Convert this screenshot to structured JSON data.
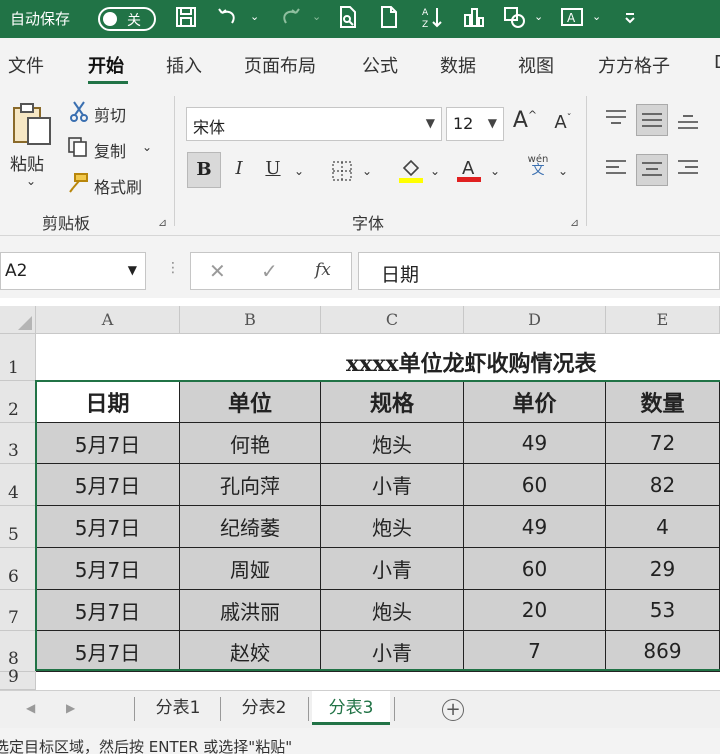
{
  "titlebar": {
    "autosave_label": "自动保存",
    "toggle_state": "关",
    "icons": [
      "save-icon",
      "undo-icon",
      "redo-icon",
      "print-preview-icon",
      "new-file-icon",
      "sort-icon",
      "chart-icon",
      "shapes-icon",
      "textbox-icon",
      "customize-icon"
    ]
  },
  "tabs": [
    "文件",
    "开始",
    "插入",
    "页面布局",
    "公式",
    "数据",
    "视图",
    "方方格子",
    "D"
  ],
  "ribbon": {
    "paste": "粘贴",
    "cut": "剪切",
    "copy": "复制",
    "format_painter": "格式刷",
    "clipboard_group": "剪贴板",
    "font_name": "宋体",
    "font_size": "12",
    "font_group": "字体",
    "bold": "B",
    "italic": "I",
    "underline": "U",
    "phonetic_top": "wén",
    "phonetic_bottom": "文"
  },
  "formula_bar": {
    "name_box": "A2",
    "formula": "日期"
  },
  "sheet": {
    "columns": [
      "A",
      "B",
      "C",
      "D",
      "E"
    ],
    "rows": [
      "1",
      "2",
      "3",
      "4",
      "5",
      "6",
      "7",
      "8",
      "9"
    ],
    "title": "xxxx单位龙虾收购情况表",
    "headers": [
      "日期",
      "单位",
      "规格",
      "单价",
      "数量"
    ],
    "data": [
      [
        "5月7日",
        "何艳",
        "炮头",
        "49",
        "72"
      ],
      [
        "5月7日",
        "孔向萍",
        "小青",
        "60",
        "82"
      ],
      [
        "5月7日",
        "纪绮萎",
        "炮头",
        "49",
        "4"
      ],
      [
        "5月7日",
        "周娅",
        "小青",
        "60",
        "29"
      ],
      [
        "5月7日",
        "戚洪丽",
        "炮头",
        "20",
        "53"
      ],
      [
        "5月7日",
        "赵姣",
        "小青",
        "7",
        "869"
      ]
    ]
  },
  "sheet_tabs": [
    "分表1",
    "分表2",
    "分表3"
  ],
  "active_sheet": "分表3",
  "status": "选定目标区域，然后按 ENTER 或选择\"粘贴\"",
  "colors": {
    "accent": "#217346",
    "selection": "#d0d0d0"
  }
}
